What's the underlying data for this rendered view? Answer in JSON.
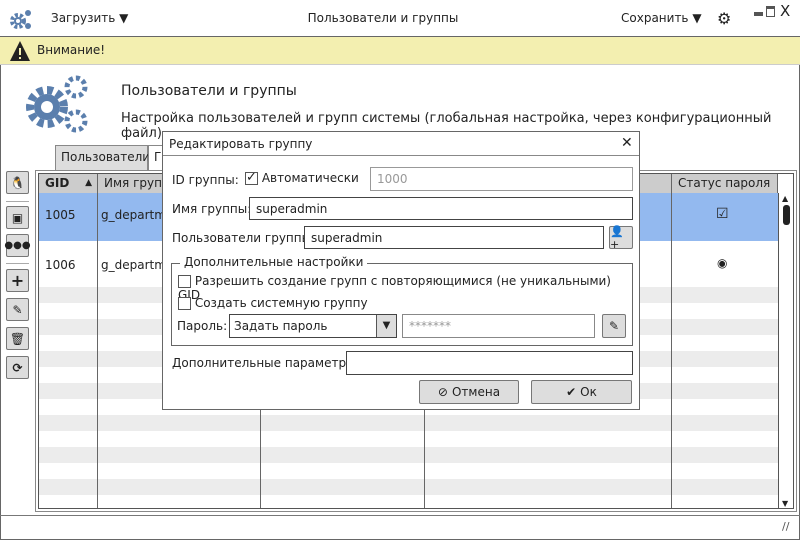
{
  "window": {
    "title": "Пользователи и группы",
    "load_label": "Загрузить",
    "save_label": "Сохранить"
  },
  "warning": {
    "text": "Внимание!"
  },
  "header": {
    "title": "Пользователи и группы",
    "subtitle": "Настройка пользователей и групп системы (глобальная настройка, через конфигурационный файл)"
  },
  "tabs": [
    {
      "label": "Пользователи"
    },
    {
      "label": "Г"
    }
  ],
  "table": {
    "columns": [
      "GID",
      "Имя группы",
      "",
      "",
      "Статус пароля"
    ],
    "rows": [
      {
        "gid": "1005",
        "name": "g_departm",
        "status": "checkbox",
        "selected": true
      },
      {
        "gid": "1006",
        "name": "g_departm",
        "status": "radio",
        "selected": false
      }
    ]
  },
  "dialog": {
    "title": "Редактировать группу",
    "gid_label": "ID группы:",
    "auto_label": "Автоматически",
    "auto_checked": true,
    "gid_value": "1000",
    "name_label": "Имя группы:",
    "name_value": "superadmin",
    "users_label": "Пользователи группы:",
    "users_value": "superadmin",
    "extra_group_label": "Дополнительные настройки",
    "allow_dup_label": "Разрешить создание групп с повторяющимися (не уникальными) GID",
    "system_group_label": "Создать системную группу",
    "password_label": "Пароль:",
    "password_mode": "Задать пароль",
    "password_value": "*******",
    "params_label": "Дополнительные параметры:",
    "params_value": "",
    "cancel_label": "Отмена",
    "ok_label": "Ок"
  },
  "colors": {
    "accent": "#5b7fad",
    "selected_row": "#93b9ef",
    "warning_bg": "#f3efb0"
  }
}
